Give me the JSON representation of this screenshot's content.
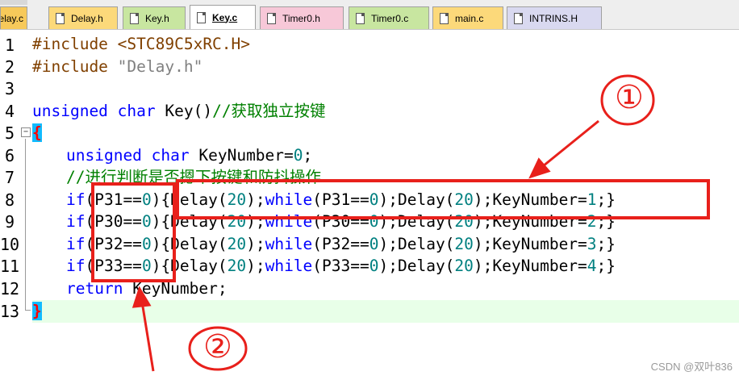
{
  "tabs": [
    {
      "label": "elay.c",
      "active": false,
      "color": "#f7c95a"
    },
    {
      "label": "Delay.h",
      "active": false,
      "color": "#fcd97a"
    },
    {
      "label": "Key.h",
      "active": false,
      "color": "#c8e6a0"
    },
    {
      "label": "Key.c",
      "active": true,
      "color": "#ffffff"
    },
    {
      "label": "Timer0.h",
      "active": false,
      "color": "#f7c8d8"
    },
    {
      "label": "Timer0.c",
      "active": false,
      "color": "#c8e6a0"
    },
    {
      "label": "main.c",
      "active": false,
      "color": "#fcd97a"
    },
    {
      "label": "INTRINS.H",
      "active": false,
      "color": "#d9d9f0"
    }
  ],
  "line_numbers": [
    "1",
    "2",
    "3",
    "4",
    "5",
    "6",
    "7",
    "8",
    "9",
    "10",
    "11",
    "12",
    "13"
  ],
  "fold_marker": "−",
  "code": {
    "l1_pp": "#include",
    "l1_rest": " <STC89C5xRC.H>",
    "l2_pp": "#include",
    "l2_str": " \"Delay.h\"",
    "l4_kw": "unsigned char",
    "l4_fn": " Key()",
    "l4_cm": "//获取独立按键",
    "l5_brace": "{",
    "l6_kw": "unsigned char",
    "l6_rest": " KeyNumber=",
    "l6_num": "0",
    "l6_end": ";",
    "l7_cm": "//进行判断是否摁下按键和防抖操作",
    "if_lines": [
      {
        "kw_if": "if",
        "cond": "(P31==",
        "c_num": "0",
        "c_close": ")",
        "a": "{Delay(",
        "d_num": "20",
        "b": ");",
        "kw_while": "while",
        "w": "(P31==",
        "w_num": "0",
        "c": ");Delay(",
        "d2": "20",
        "e": ");KeyNumber=",
        "k": "1",
        "f": ";}"
      },
      {
        "kw_if": "if",
        "cond": "(P30==",
        "c_num": "0",
        "c_close": ")",
        "a": "{Delay(",
        "d_num": "20",
        "b": ");",
        "kw_while": "while",
        "w": "(P30==",
        "w_num": "0",
        "c": ");Delay(",
        "d2": "20",
        "e": ");KeyNumber=",
        "k": "2",
        "f": ";}"
      },
      {
        "kw_if": "if",
        "cond": "(P32==",
        "c_num": "0",
        "c_close": ")",
        "a": "{Delay(",
        "d_num": "20",
        "b": ");",
        "kw_while": "while",
        "w": "(P32==",
        "w_num": "0",
        "c": ");Delay(",
        "d2": "20",
        "e": ");KeyNumber=",
        "k": "3",
        "f": ";}"
      },
      {
        "kw_if": "if",
        "cond": "(P33==",
        "c_num": "0",
        "c_close": ")",
        "a": "{Delay(",
        "d_num": "20",
        "b": ");",
        "kw_while": "while",
        "w": "(P33==",
        "w_num": "0",
        "c": ");Delay(",
        "d2": "20",
        "e": ");KeyNumber=",
        "k": "4",
        "f": ";}"
      }
    ],
    "l12_kw": "return",
    "l12_rest": " KeyNumber;",
    "l13_brace": "}"
  },
  "annotations": {
    "label1": "①",
    "label2": "②",
    "color": "#e8201b"
  },
  "watermark": "CSDN @双叶836"
}
